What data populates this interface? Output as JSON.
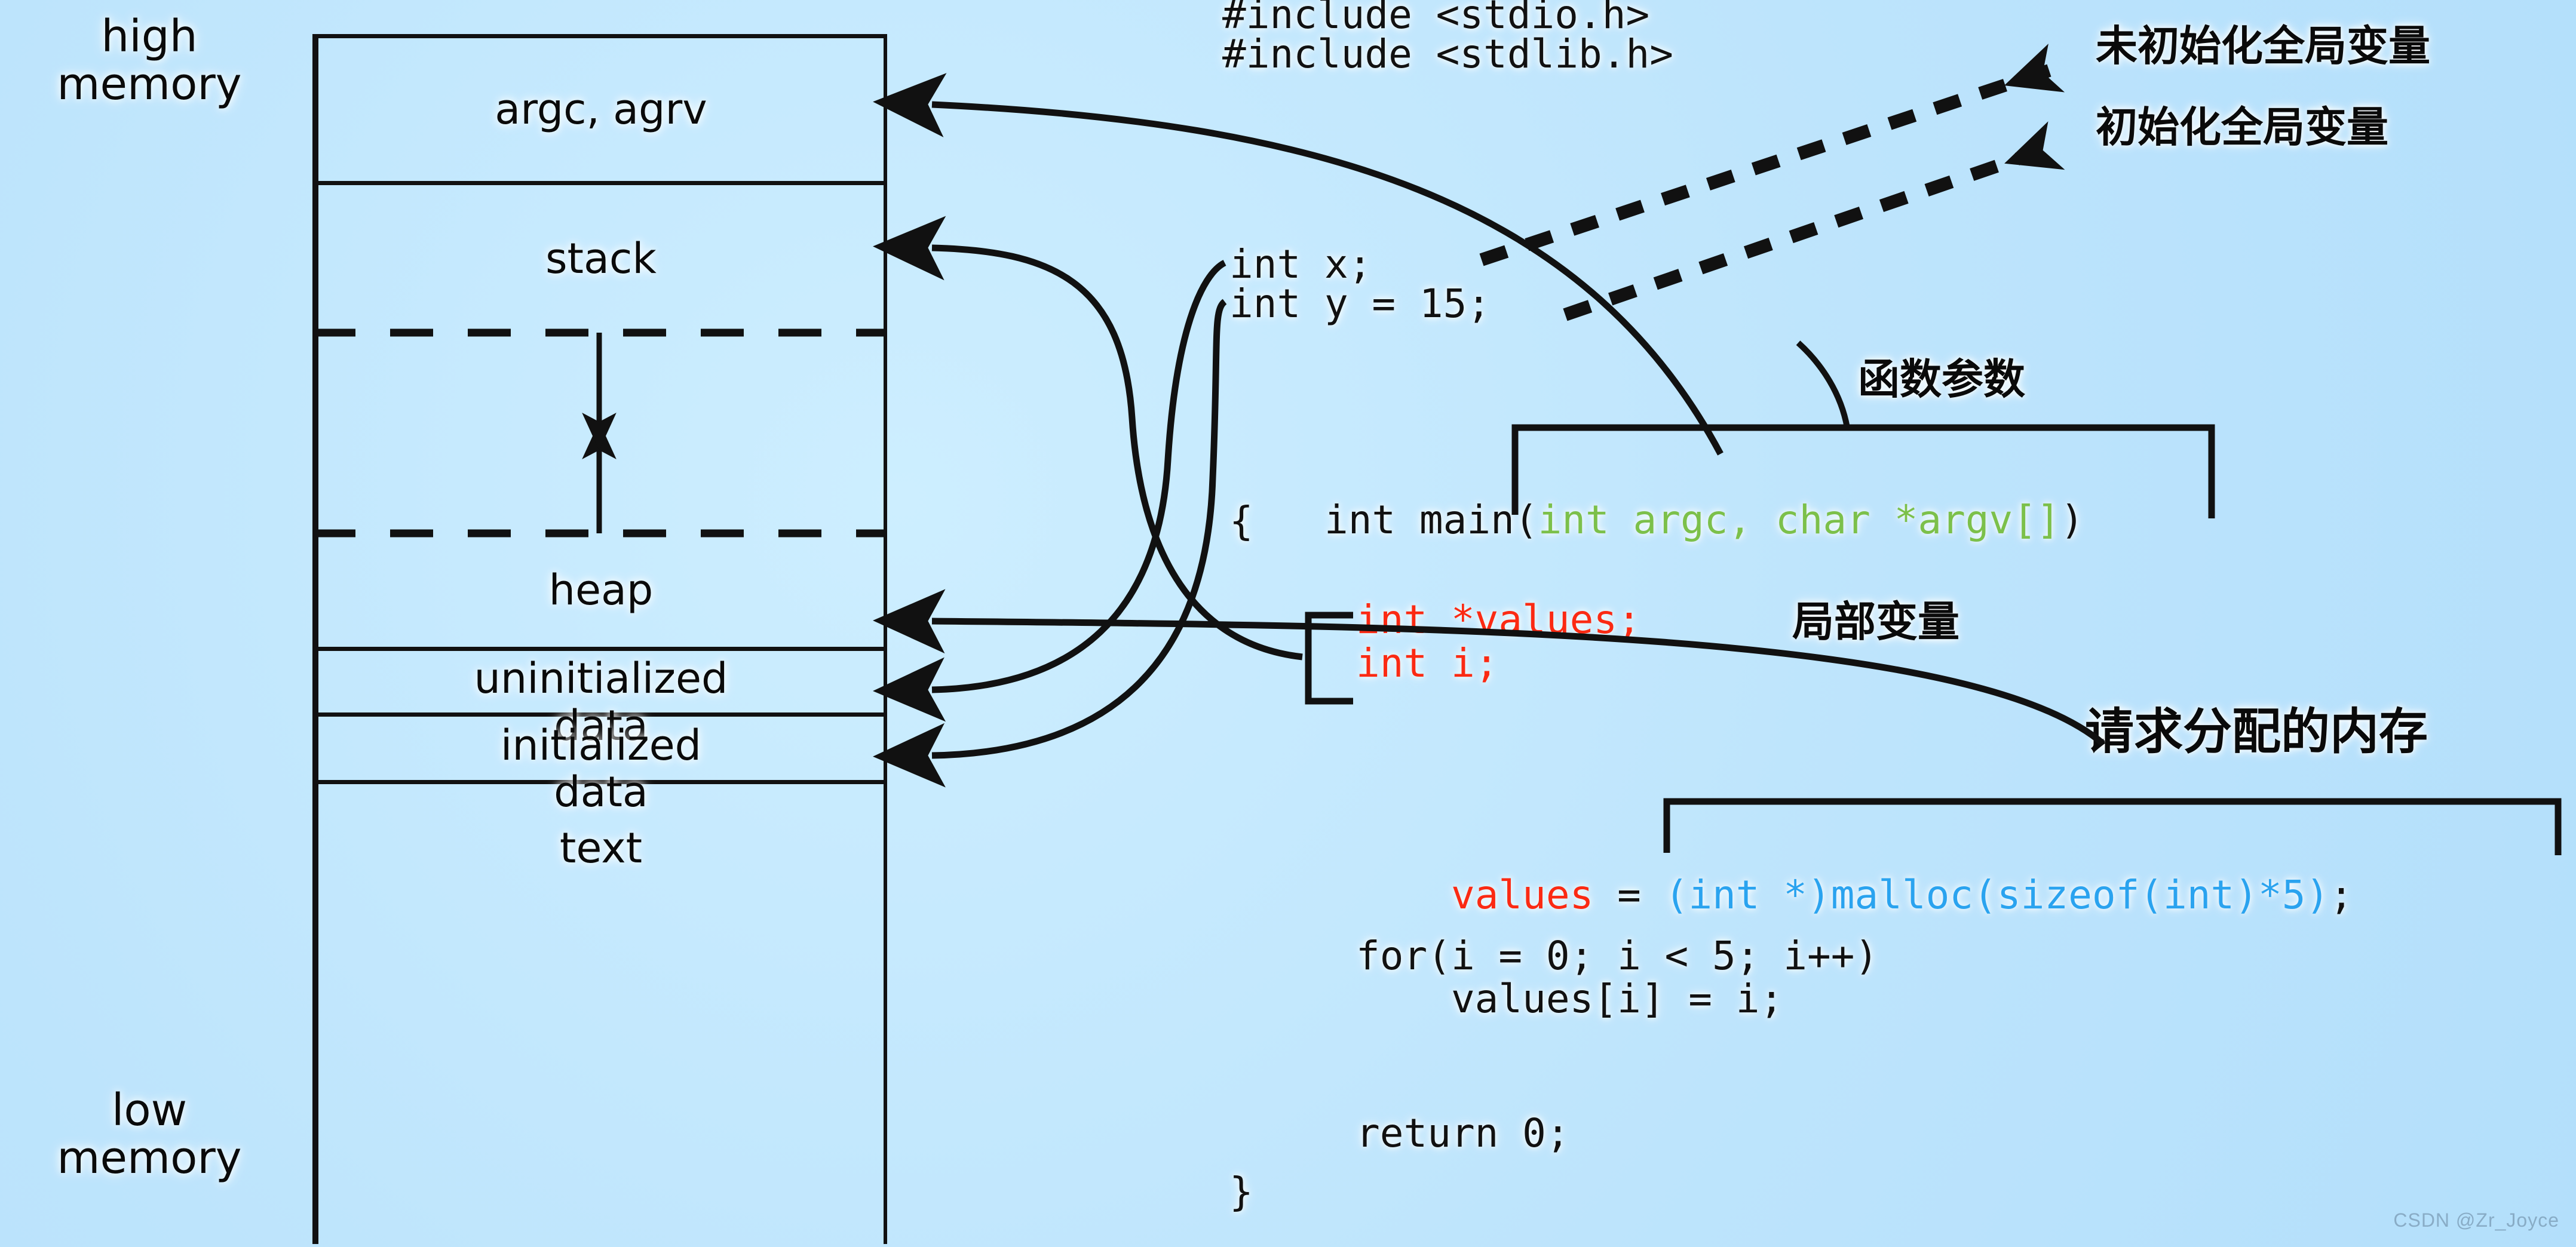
{
  "background_color": "#bde6fd",
  "memory_layout": {
    "top_label": "high\nmemory",
    "bottom_label": "low\nmemory",
    "segments": [
      {
        "label": "argc, agrv"
      },
      {
        "label": "stack"
      },
      {
        "label": "heap"
      },
      {
        "label": "uninitialized\ndata"
      },
      {
        "label": "initialized\ndata"
      },
      {
        "label": "text"
      }
    ]
  },
  "code": {
    "lines": [
      {
        "text": "#include <stdio.h>"
      },
      {
        "text": "#include <stdlib.h>"
      },
      {
        "text": "int x;"
      },
      {
        "text": "int y = 15;"
      },
      {
        "text": "int main("
      },
      {
        "text": "int argc, char *argv[]",
        "color": "green"
      },
      {
        "text": ")"
      },
      {
        "text": "{"
      },
      {
        "text": "int *values;",
        "color": "red"
      },
      {
        "text": "int i;",
        "color": "red"
      },
      {
        "text": "values",
        "color": "red"
      },
      {
        "text": " = "
      },
      {
        "text": "(int *)malloc(sizeof(int)*5)",
        "color": "blue"
      },
      {
        "text": ";"
      },
      {
        "text": "for(i = 0; i < 5; i++)"
      },
      {
        "text": "    values[i] = i;"
      },
      {
        "text": "return 0;"
      },
      {
        "text": "}"
      }
    ],
    "colors": {
      "green": "#7cc04a",
      "red": "#fb2a13",
      "blue": "#2aa3ef",
      "black": "#111111"
    }
  },
  "annotations": [
    {
      "id": "uninit-global",
      "text": "未初始化全局变量"
    },
    {
      "id": "init-global",
      "text": "初始化全局变量"
    },
    {
      "id": "func-params",
      "text": "函数参数"
    },
    {
      "id": "local-vars",
      "text": "局部变量"
    },
    {
      "id": "requested-memory",
      "text": "请求分配的内存"
    }
  ],
  "watermark": {
    "text": "CSDN @Zr_Joyce"
  }
}
